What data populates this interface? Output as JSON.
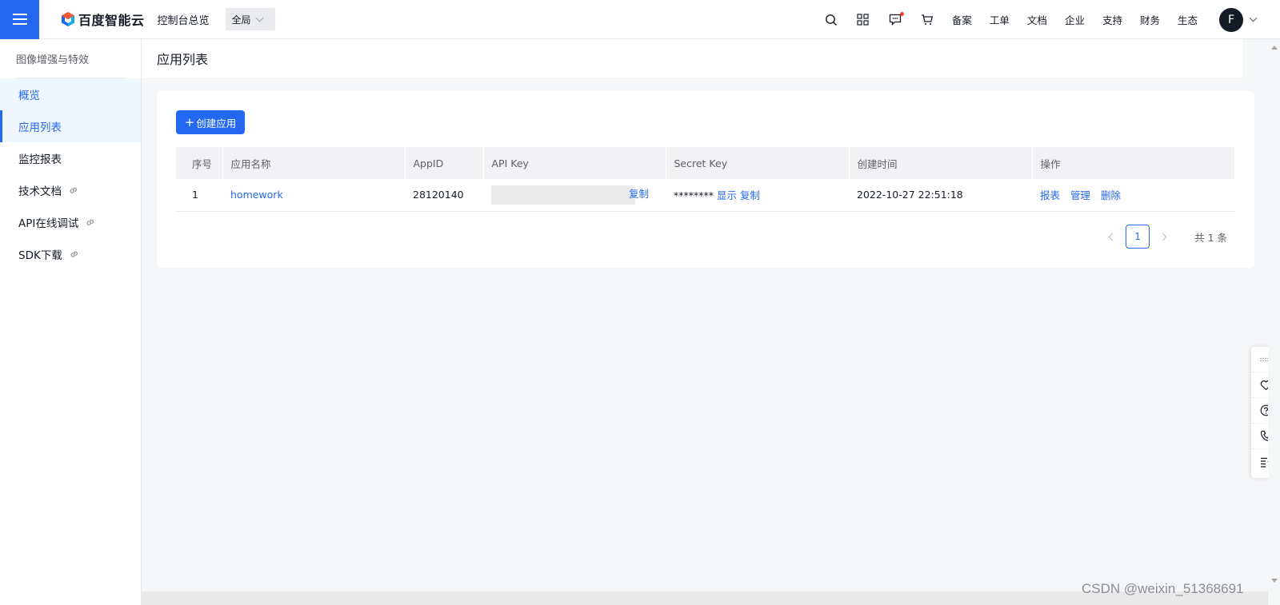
{
  "topbar": {
    "logo_text": "百度智能云",
    "console_link": "控制台总览",
    "region": "全局",
    "nav": [
      "备案",
      "工单",
      "文档",
      "企业",
      "支持",
      "财务",
      "生态"
    ],
    "avatar_letter": "F"
  },
  "sidebar": {
    "title": "图像增强与特效",
    "items": [
      {
        "label": "概览"
      },
      {
        "label": "应用列表"
      },
      {
        "label": "监控报表"
      },
      {
        "label": "技术文档"
      },
      {
        "label": "API在线调试"
      },
      {
        "label": "SDK下载"
      }
    ]
  },
  "page": {
    "title": "应用列表",
    "create_button": "创建应用"
  },
  "table": {
    "headers": [
      "序号",
      "应用名称",
      "AppID",
      "API Key",
      "Secret Key",
      "创建时间",
      "操作"
    ],
    "rows": [
      {
        "index": "1",
        "name": "homework",
        "appid": "28120140",
        "api_key_action": "复制",
        "secret_masked": "********",
        "secret_show": "显示",
        "secret_copy": "复制",
        "created": "2022-10-27 22:51:18",
        "ops": [
          "报表",
          "管理",
          "删除"
        ]
      }
    ]
  },
  "pagination": {
    "current": "1",
    "total": "共 1 条"
  },
  "watermark": "CSDN @weixin_51368691",
  "colors": {
    "primary": "#2468f2",
    "menu_bg": "#2468f2",
    "page_bg": "#f5f6f8"
  }
}
